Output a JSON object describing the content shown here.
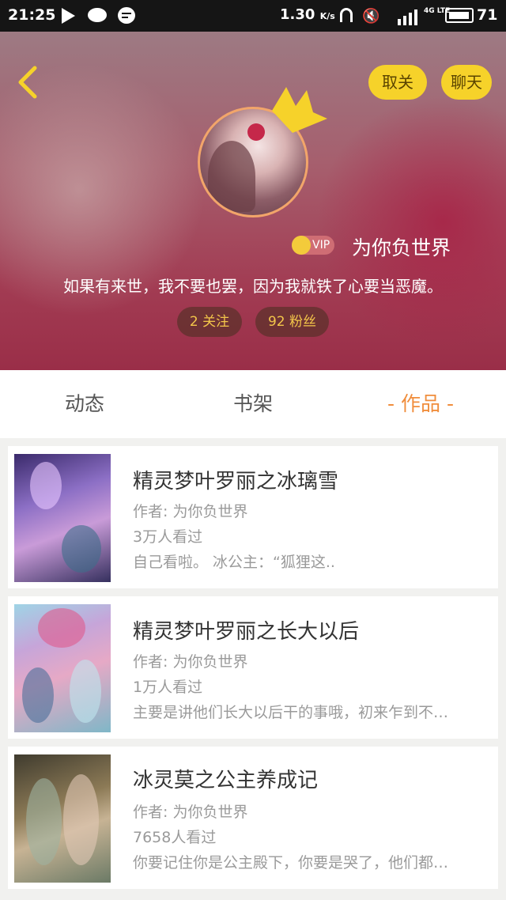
{
  "status_bar": {
    "time": "21:25",
    "speed": "1.30",
    "speed_unit": "K/s",
    "network": "4G LTE",
    "battery": "71",
    "icons": [
      "play-icon",
      "chat-bubble-icon",
      "message-icon",
      "headphone-icon",
      "mute-icon",
      "signal-icon",
      "battery-icon"
    ]
  },
  "header": {
    "back_icon": "chevron-left-icon",
    "unfollow_label": "取关",
    "chat_label": "聊天",
    "username": "为你负世界",
    "vip_label": "VIP",
    "bio": "如果有来世，我不要也罢，因为我就铁了心要当恶魔。",
    "following": "2 关注",
    "fans": "92 粉丝",
    "accent_color": "#f6d22a"
  },
  "tabs": [
    {
      "label": "动态"
    },
    {
      "label": "书架"
    },
    {
      "label": "- 作品 -",
      "active": true
    }
  ],
  "works": [
    {
      "title": "精灵梦叶罗丽之冰璃雪",
      "author": "作者: 为你负世界",
      "views": "3万人看过",
      "desc": "自己看啦。 冰公主：“狐狸这.."
    },
    {
      "title": "精灵梦叶罗丽之长大以后",
      "author": "作者: 为你负世界",
      "views": "1万人看过",
      "desc": "主要是讲他们长大以后干的事哦，初来乍到不…"
    },
    {
      "title": "冰灵莫之公主养成记",
      "author": "作者: 为你负世界",
      "views": "7658人看过",
      "desc": "你要记住你是公主殿下，你要是哭了，他们都…"
    }
  ]
}
